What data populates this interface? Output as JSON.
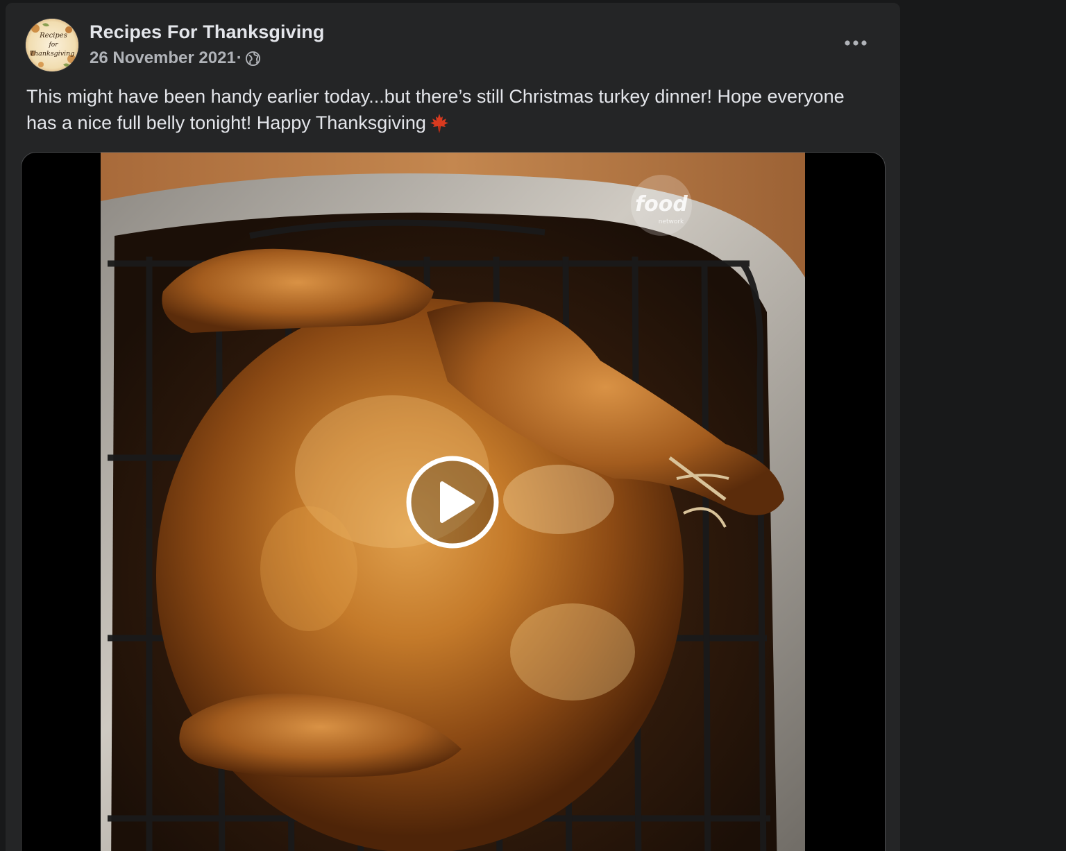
{
  "post": {
    "page_name": "Recipes For Thanksgiving",
    "avatar_text": "Recipes for Thanksgiving",
    "date": "26 November 2021",
    "separator": "·",
    "audience_icon": "globe-icon",
    "more_icon": "more-options-icon",
    "text": "This might have been handy earlier today...but there’s still Christmas turkey dinner! Hope everyone has a nice full belly tonight! Happy Thanksgiving",
    "emoji_icon": "maple-leaf-icon"
  },
  "video": {
    "play_icon": "play-icon",
    "watermark": "food network",
    "watermark_top": "food",
    "watermark_bottom": "network"
  },
  "colors": {
    "background": "#18191a",
    "card": "#242526",
    "primary_text": "#e4e6eb",
    "secondary_text": "#b0b3b8",
    "maple": "#d93a1f"
  }
}
